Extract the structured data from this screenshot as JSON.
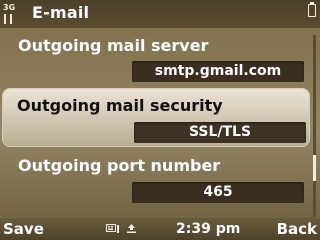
{
  "status": {
    "signal_label": "3G",
    "title": "E-mail"
  },
  "settings": [
    {
      "label": "Outgoing mail server",
      "value": "smtp.gmail.com",
      "selected": false
    },
    {
      "label": "Outgoing mail security",
      "value": "SSL/TLS",
      "selected": true
    },
    {
      "label": "Outgoing port number",
      "value": "465",
      "selected": false
    }
  ],
  "softkeys": {
    "left": "Save",
    "right": "Back",
    "time": "2:39 pm",
    "indicators": [
      "keyboard-icon",
      "upload-icon"
    ]
  },
  "colors": {
    "background": "#8c7c5b",
    "selected_row": "#d8cfba",
    "value_box": "#3a2f1f"
  }
}
